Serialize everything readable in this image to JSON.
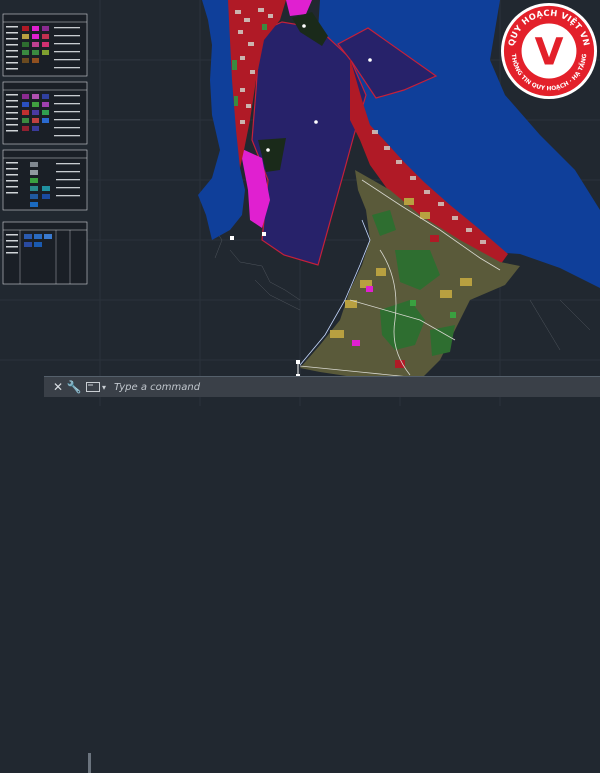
{
  "command_line": {
    "close_icon": "close-icon",
    "customize_icon": "wrench-icon",
    "prompt_icon": "command-prompt-icon",
    "placeholder": "Type a command"
  },
  "watermark": {
    "logo_letter": "V",
    "ring_text_top": "QUY HOẠCH VIỆT VN",
    "ring_text_bottom": "THÔNG TIN QUY HOẠCH · HẠ TẦNG",
    "colors": {
      "ring": "#e3202a",
      "inner": "#ffffff"
    }
  },
  "colors": {
    "background": "#212830",
    "sea": "#0f3f9a",
    "plot_fill": "#27226a",
    "residential": "#b01a26",
    "magenta": "#e020d0",
    "land_green": "#2e6e30",
    "land_yellow": "#b8a040"
  }
}
